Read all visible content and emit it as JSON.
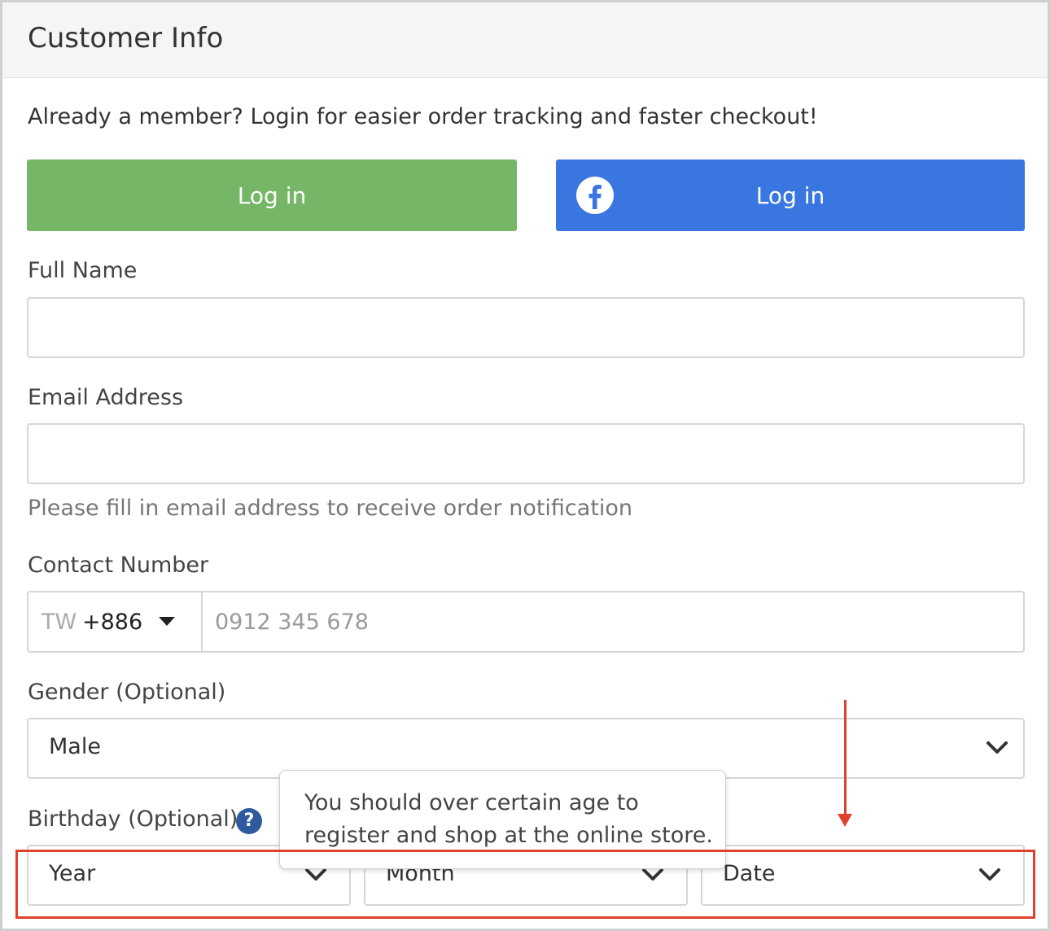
{
  "header": {
    "title": "Customer Info"
  },
  "intro_text": "Already a member? Login for easier order tracking and faster checkout!",
  "login": {
    "member_label": "Log in",
    "facebook_label": "Log in"
  },
  "full_name": {
    "label": "Full Name",
    "value": ""
  },
  "email": {
    "label": "Email Address",
    "value": "",
    "hint": "Please fill in email address to receive order notification"
  },
  "contact": {
    "label": "Contact Number",
    "country_code": "TW",
    "dial_code": "+886",
    "placeholder": "0912 345 678"
  },
  "gender": {
    "label": "Gender (Optional)",
    "value": "Male"
  },
  "birthday": {
    "label": "Birthday (Optional)",
    "help_icon": "?",
    "tooltip_line1": "You should over certain age to",
    "tooltip_line2": "register and shop at the online store.",
    "year": "Year",
    "month": "Month",
    "date": "Date"
  },
  "colors": {
    "green": "#75b667",
    "facebook_blue": "#3a76e0",
    "annotation_red": "#e0412c",
    "help_blue": "#2f5b9e"
  },
  "icons": {
    "facebook": "facebook-icon",
    "chevron": "chevron-down-icon",
    "caret": "caret-down-icon",
    "help": "help-icon"
  }
}
